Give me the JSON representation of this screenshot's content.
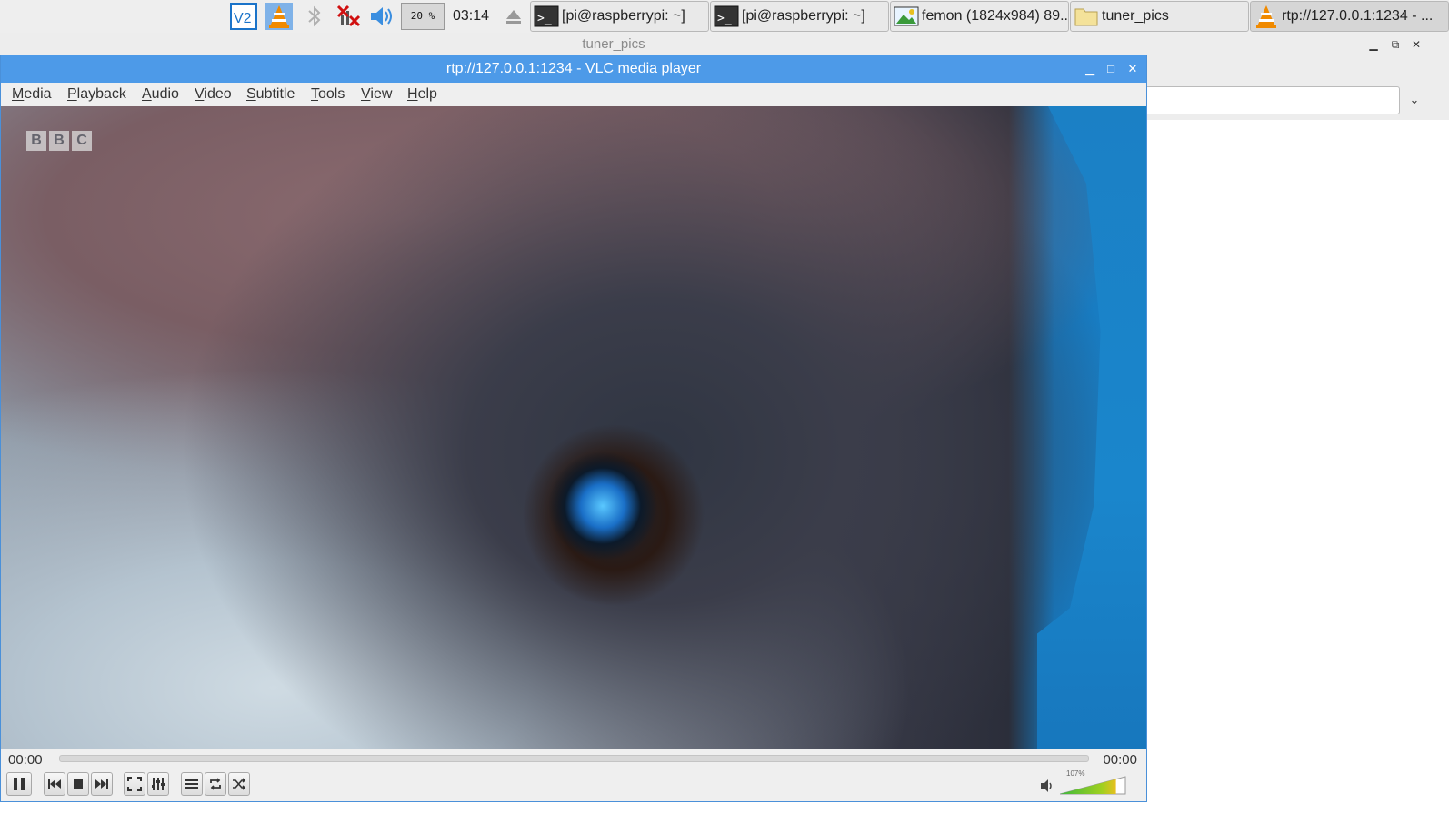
{
  "taskbar": {
    "cpu_label": "20 %",
    "clock": "03:14",
    "icons": {
      "vnc": "vnc-icon",
      "vlc": "vlc-cone-icon",
      "bluetooth": "bluetooth-icon",
      "network": "network-disconnected-icon",
      "volume": "volume-icon",
      "eject": "eject-icon"
    },
    "tasks": [
      {
        "label": "[pi@raspberrypi: ~]",
        "icon": "terminal-icon"
      },
      {
        "label": "[pi@raspberrypi: ~]",
        "icon": "terminal-icon"
      },
      {
        "label": "femon (1824x984) 89...",
        "icon": "image-viewer-icon"
      },
      {
        "label": "tuner_pics",
        "icon": "folder-icon"
      },
      {
        "label": "rtp://127.0.0.1:1234 - ...",
        "icon": "vlc-cone-icon"
      }
    ]
  },
  "background_window": {
    "title": "tuner_pics"
  },
  "vlc": {
    "title": "rtp://127.0.0.1:1234 - VLC media player",
    "menu": [
      "Media",
      "Playback",
      "Audio",
      "Video",
      "Subtitle",
      "Tools",
      "View",
      "Help"
    ],
    "overlay_logo": [
      "B",
      "B",
      "C"
    ],
    "time_elapsed": "00:00",
    "time_total": "00:00",
    "seek_progress": 0,
    "volume_label": "107%",
    "volume_level": 1.07,
    "colors": {
      "titlebar": "#4d9ae8",
      "volume_low": "#3cb83c",
      "volume_high": "#e8c020"
    }
  }
}
